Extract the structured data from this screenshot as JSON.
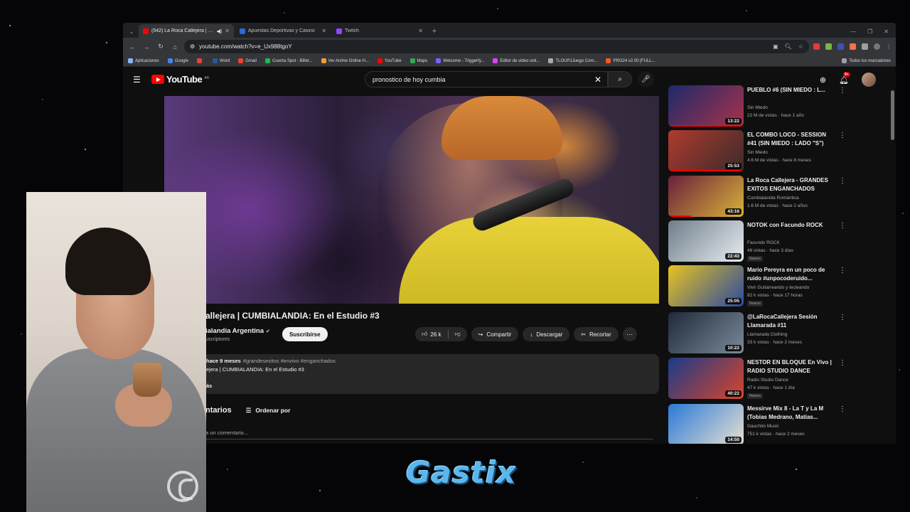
{
  "browser": {
    "tabs": [
      {
        "title": "(542) La Roca Callejera | CU",
        "active": true,
        "favicon_color": "#ff0000"
      },
      {
        "title": "Apuestas Deportivas y Casino",
        "active": false,
        "favicon_color": "#2a6ad8"
      },
      {
        "title": "Twitch",
        "active": false,
        "favicon_color": "#9146ff"
      }
    ],
    "url": "youtube.com/watch?v=e_Ux988tgoY",
    "bookmarks": [
      {
        "label": "Aplicaciones",
        "color": "#8ab4f8"
      },
      {
        "label": "Google",
        "color": "#4285f4"
      },
      {
        "label": "",
        "color": "#ea4335"
      },
      {
        "label": "Word",
        "color": "#2b579a"
      },
      {
        "label": "Gmail",
        "color": "#ea4335"
      },
      {
        "label": "Cuenta Spot - Billet...",
        "color": "#1db954"
      },
      {
        "label": "Ver Anime Online H...",
        "color": "#f0a030"
      },
      {
        "label": "YouTube",
        "color": "#ff0000"
      },
      {
        "label": "Maps",
        "color": "#34a853"
      },
      {
        "label": "Welcome - Triggerfy...",
        "color": "#7b61ff"
      },
      {
        "label": "Editor de video onli...",
        "color": "#e040fb"
      },
      {
        "label": "TLOUP1Juego Com...",
        "color": "#aaaaaa"
      },
      {
        "label": "PRO24 v2.00 [FULL...",
        "color": "#ff5722"
      }
    ],
    "all_bookmarks": "Todos los marcadores"
  },
  "youtube": {
    "logo": "YouTube",
    "country": "AR",
    "search_query": "pronostico de hoy cumbia",
    "notifications_badge": "9+"
  },
  "video": {
    "title": "allejera | CUMBIALANDIA: En el Estudio #3",
    "channel": "ialandia Argentina",
    "subscribers": "uscriptores",
    "subscribe_label": "Suscribirse",
    "likes": "26 k",
    "share_label": "Compartir",
    "download_label": "Descargar",
    "clip_label": "Recortar",
    "desc_meta": "hace 9 meses",
    "desc_tags": "#grandesexitos #envivo #enganchados",
    "desc_line2": "ejera | CUMBIALANDIA: En el Estudio #3",
    "desc_more": "ás",
    "comments_title": "ntarios",
    "sort_label": "Ordenar por",
    "add_comment_placeholder": "a un comentario..."
  },
  "recommendations": [
    {
      "title": "PUEBLO #6 (SIN MIEDO : L...",
      "channel": "Sin Miedo",
      "meta": "22 M de vistas · hace 1 año",
      "duration": "13:22",
      "new": "",
      "progress": 1.0
    },
    {
      "title": "EL COMBO LOCO - SESSION #41 (SIN MIEDO : LADO \"S\")",
      "channel": "Sin Miedo",
      "meta": "4.6 M de vistas · hace 8 meses",
      "duration": "25:53",
      "new": "",
      "progress": 1.0
    },
    {
      "title": "La Roca Callejera - GRANDES EXITOS ENGANCHADOS",
      "channel": "Cumbialandia Romántica",
      "meta": "1.6 M de vistas · hace 2 años",
      "duration": "43:16",
      "new": "",
      "progress": 0.3
    },
    {
      "title": "NOTOK con Facundo ROCK",
      "channel": "Facundo ROCK",
      "meta": "46 vistas · hace 3 días",
      "duration": "22:43",
      "new": "Nuevo",
      "progress": 0
    },
    {
      "title": "Mario Pereyra en un poco de ruido #unpocoderuido...",
      "channel": "Vivir Guitarreando y tecleando",
      "meta": "82 k vistas · hace 17 horas",
      "duration": "25:05",
      "new": "Nuevo",
      "progress": 0
    },
    {
      "title": "@LaRocaCallejera Sesión Llamarada #11",
      "channel": "Llamarada Clothing",
      "meta": "33 k vistas · hace 2 meses",
      "duration": "10:22",
      "new": "",
      "progress": 0
    },
    {
      "title": "NESTOR EN BLOQUE En Vivo | RADIO STUDIO DANCE",
      "channel": "Radio Studio Dance",
      "meta": "47 k vistas · hace 1 día",
      "duration": "40:22",
      "new": "Nuevo",
      "progress": 0
    },
    {
      "title": "Messirve Mix 8 - La T y La M (Tobias Medrano, Matias...",
      "channel": "Gauchito Music",
      "meta": "751 k vistas · hace 2 meses",
      "duration": "14:50",
      "new": "",
      "progress": 0
    }
  ],
  "overlay": {
    "brand_text": "Gastix"
  }
}
